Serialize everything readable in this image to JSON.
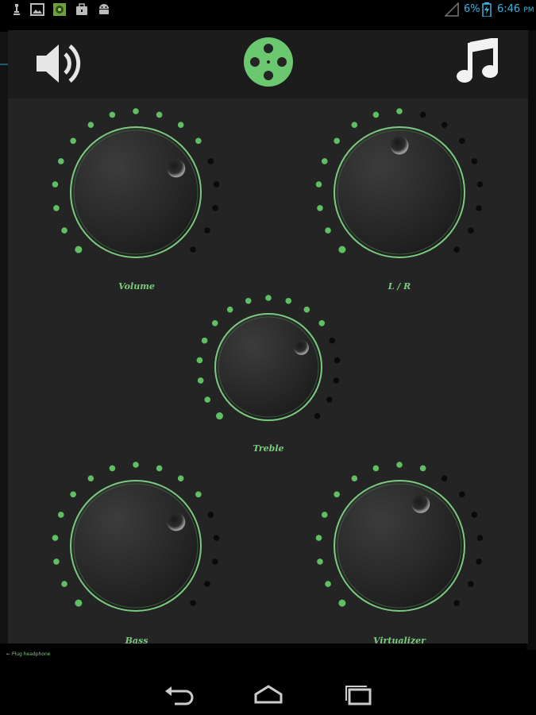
{
  "status_bar": {
    "battery_percent": "6%",
    "time": "6:46",
    "ampm": "PM",
    "left_icons": [
      "chess-icon",
      "gallery-icon",
      "app-icon",
      "briefcase-icon",
      "android-icon"
    ]
  },
  "header": {
    "speaker_icon": "speaker-icon",
    "center_icon": "film-reel-icon",
    "music_icon": "music-note-icon"
  },
  "knobs": {
    "volume": {
      "label": "Volume",
      "level": 0.72
    },
    "lr": {
      "label": "L / R",
      "level": 0.5
    },
    "treble": {
      "label": "Treble",
      "level": 0.72
    },
    "bass": {
      "label": "Bass",
      "level": 0.72
    },
    "virtualizer": {
      "label": "Virtualizer",
      "level": 0.6
    }
  },
  "hint": "← Plug headphone",
  "colors": {
    "accent": "#7acb7f",
    "led_on": "#5fbf62",
    "led_off": "#0a0a0a",
    "panel": "#242424",
    "status_text": "#33b5e5"
  }
}
